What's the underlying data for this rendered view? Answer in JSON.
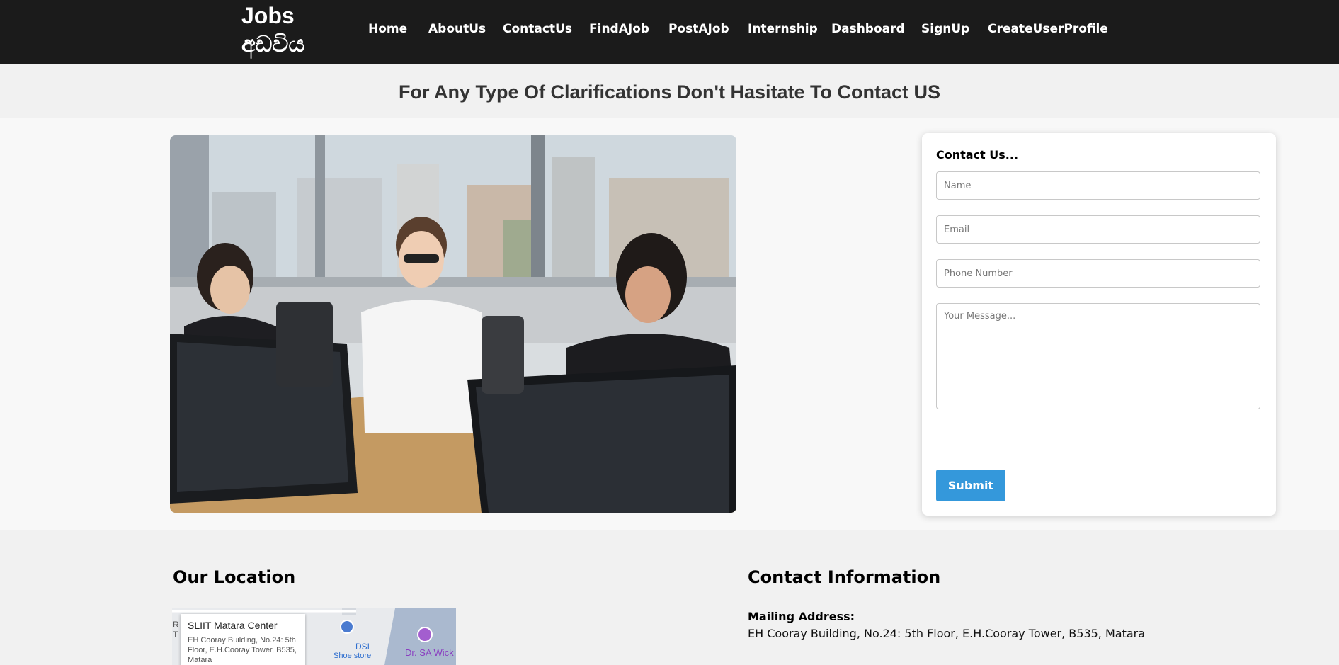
{
  "header": {
    "brand_line1": "Jobs",
    "brand_line2": "අඩවිය",
    "nav": [
      "Home",
      "AboutUs",
      "ContactUs",
      "FindAJob",
      "PostAJob",
      "Internship",
      "Dashboard",
      "SignUp",
      "CreateUserProfile"
    ]
  },
  "page_title": "For Any Type Of Clarifications Don't Hasitate To Contact US",
  "form": {
    "title": "Contact Us...",
    "name_placeholder": "Name",
    "email_placeholder": "Email",
    "phone_placeholder": "Phone Number",
    "message_placeholder": "Your Message...",
    "submit_label": "Submit"
  },
  "location": {
    "heading": "Our Location",
    "map": {
      "place_name": "SLIIT Matara Center",
      "place_address": "EH Cooray Building, No.24: 5th Floor, E.H.Cooray Tower, B535, Matara",
      "label_dsi": "DSI",
      "label_shoe": "Shoe store",
      "label_statue": "Dr. SA Wick Statue (Firs"
    }
  },
  "contact_info": {
    "heading": "Contact Information",
    "mailing_label": "Mailing Address:",
    "mailing_value": "EH Cooray Building, No.24: 5th Floor, E.H.Cooray Tower, B535, Matara"
  },
  "colors": {
    "header_bg": "#1b1b1b",
    "submit_bg": "#3498db"
  }
}
